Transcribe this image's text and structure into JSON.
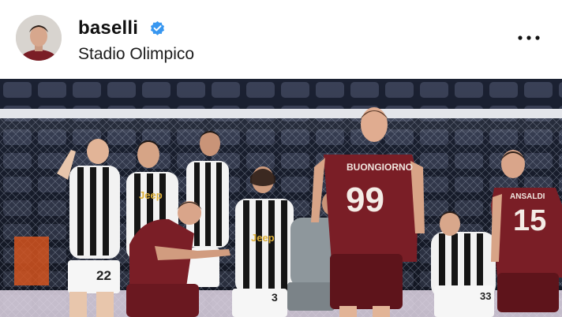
{
  "post": {
    "username": "baselli",
    "verified": true,
    "location": "Stadio Olimpico",
    "more_icon": "more-horizontal-icon",
    "avatar_icon": "profile-avatar",
    "verified_icon": "verified-badge-icon"
  },
  "photo": {
    "jerseys": {
      "left_name": "BUONGIORNO",
      "left_number": "99",
      "right_name": "ANSALDI",
      "right_number": "15",
      "wall_number_1": "22",
      "wall_number_2": "3",
      "wall_number_3": "33",
      "sponsor": "Jeep"
    }
  },
  "colors": {
    "verified": "#3897f0",
    "torino": "#7a1e26",
    "juve_white": "#f4f4f4",
    "juve_black": "#151515"
  }
}
